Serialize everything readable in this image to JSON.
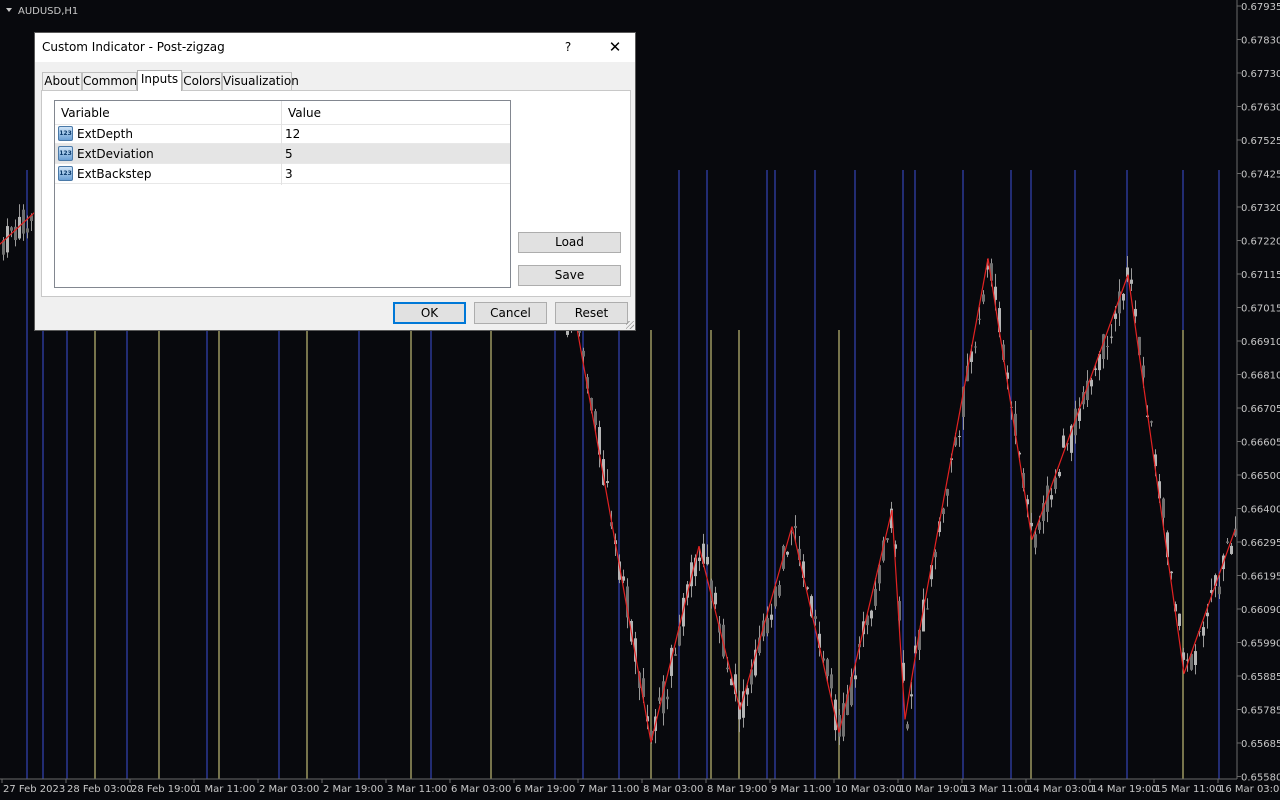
{
  "chart": {
    "symbol_label": "AUDUSD,H1",
    "colors": {
      "background": "#08090d",
      "zigzag": "#e32222",
      "blue_marker": "#3b4fd8",
      "yellow_marker": "#e6e08c",
      "candle": "#9a9a9a",
      "text": "#c8c8c8"
    },
    "price_labels": [
      "0.67935",
      "0.67830",
      "0.67730",
      "0.67630",
      "0.67525",
      "0.67425",
      "0.67320",
      "0.67220",
      "0.67115",
      "0.67015",
      "0.66910",
      "0.66810",
      "0.66705",
      "0.66605",
      "0.66500",
      "0.66400",
      "0.66295",
      "0.66195",
      "0.66090",
      "0.65990",
      "0.65885",
      "0.65785",
      "0.65685",
      "0.65580"
    ],
    "time_labels": [
      "27 Feb 2023",
      "28 Feb 03:00",
      "28 Feb 19:00",
      "1 Mar 11:00",
      "2 Mar 03:00",
      "2 Mar 19:00",
      "3 Mar 11:00",
      "6 Mar 03:00",
      "6 Mar 19:00",
      "7 Mar 11:00",
      "8 Mar 03:00",
      "8 Mar 19:00",
      "9 Mar 11:00",
      "10 Mar 03:00",
      "10 Mar 19:00",
      "13 Mar 11:00",
      "14 Mar 03:00",
      "14 Mar 19:00",
      "15 Mar 11:00",
      "16 Mar 03:00"
    ]
  },
  "chart_data": {
    "type": "line",
    "title": "AUDUSD,H1",
    "xlabel": "",
    "ylabel": "",
    "ylim": [
      0.6558,
      0.67935
    ],
    "series": [
      {
        "values": [
          [
            -5,
            0.6719
          ],
          [
            88,
            0.6745
          ],
          [
            575,
            0.6698
          ],
          [
            651,
            0.6568
          ],
          [
            699,
            0.6628
          ],
          [
            740,
            0.6578
          ],
          [
            792,
            0.6634
          ],
          [
            839,
            0.6571
          ],
          [
            892,
            0.6639
          ],
          [
            905,
            0.6575
          ],
          [
            920,
            0.6603
          ],
          [
            988,
            0.6716
          ],
          [
            1032,
            0.663
          ],
          [
            1128,
            0.6711
          ],
          [
            1184,
            0.6589
          ],
          [
            1235,
            0.6633
          ]
        ]
      }
    ]
  },
  "dialog": {
    "title": "Custom Indicator - Post-zigzag",
    "help_label": "?",
    "close_label": "✕",
    "tabs": [
      {
        "label": "About"
      },
      {
        "label": "Common"
      },
      {
        "label": "Inputs"
      },
      {
        "label": "Colors"
      },
      {
        "label": "Visualization"
      }
    ],
    "active_tab": "Inputs",
    "table": {
      "col_variable": "Variable",
      "col_value": "Value",
      "rows": [
        {
          "variable": "ExtDepth",
          "value": "12"
        },
        {
          "variable": "ExtDeviation",
          "value": "5"
        },
        {
          "variable": "ExtBackstep",
          "value": "3"
        }
      ]
    },
    "icon_text": "123",
    "buttons": {
      "load": "Load",
      "save": "Save",
      "ok": "OK",
      "cancel": "Cancel",
      "reset": "Reset"
    }
  }
}
